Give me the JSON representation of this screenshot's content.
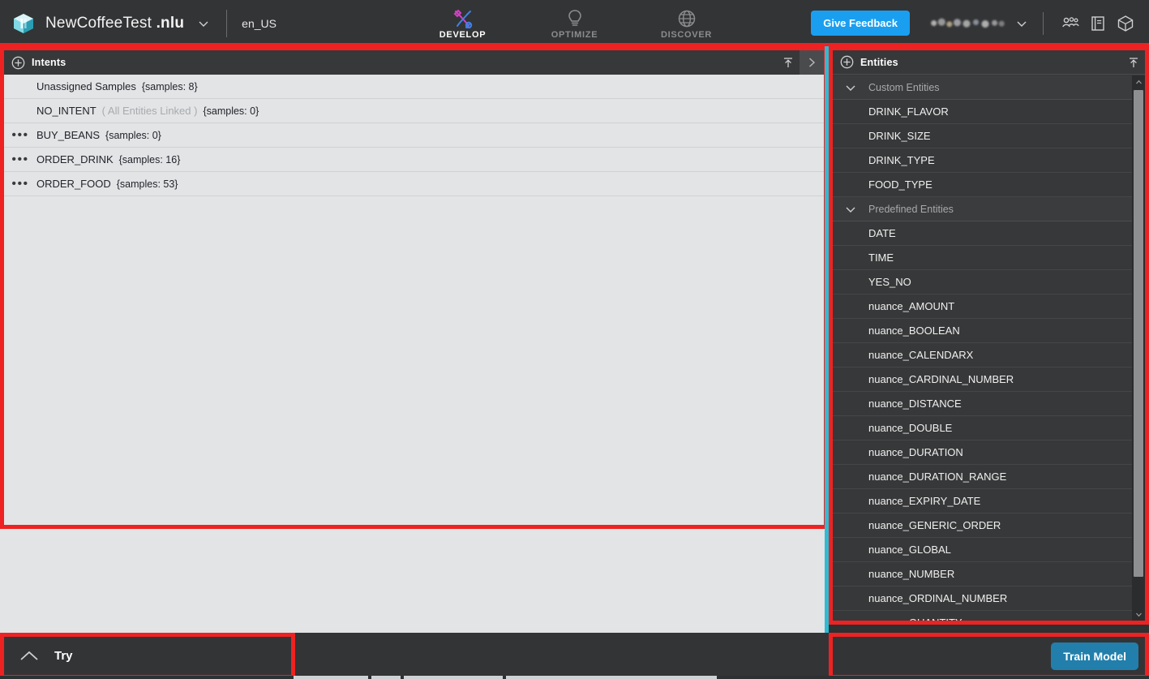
{
  "header": {
    "logo_icon": "nuance-cube-logo",
    "project_name": "NewCoffeeTest ",
    "project_ext": ".nlu",
    "project_caret_icon": "chevron-down-icon",
    "locale": "en_US",
    "feedback_label": "Give Feedback",
    "user_caret_icon": "chevron-down-icon",
    "nav": [
      {
        "label": "DEVELOP",
        "icon": "tools-icon",
        "active": true
      },
      {
        "label": "OPTIMIZE",
        "icon": "lightbulb-icon",
        "active": false
      },
      {
        "label": "DISCOVER",
        "icon": "globe-icon",
        "active": false
      }
    ],
    "icons": [
      {
        "name": "users-group-icon"
      },
      {
        "name": "book-icon"
      },
      {
        "name": "cube-icon"
      }
    ]
  },
  "intents_panel": {
    "title": "Intents",
    "add_icon": "plus-circle-icon",
    "collapse_icon": "collapse-up-icon",
    "expand_icon": "chevron-right-icon",
    "rows": [
      {
        "menu": false,
        "name": "Unassigned Samples",
        "sub": "",
        "count": "{samples: 8}"
      },
      {
        "menu": false,
        "name": "NO_INTENT",
        "sub": "( All Entities Linked )",
        "count": "{samples: 0}"
      },
      {
        "menu": true,
        "name": "BUY_BEANS",
        "sub": "",
        "count": "{samples: 0}"
      },
      {
        "menu": true,
        "name": "ORDER_DRINK",
        "sub": "",
        "count": "{samples: 16}"
      },
      {
        "menu": true,
        "name": "ORDER_FOOD",
        "sub": "",
        "count": "{samples: 53}"
      }
    ]
  },
  "entities_panel": {
    "title": "Entities",
    "add_icon": "plus-circle-icon",
    "collapse_icon": "collapse-up-icon",
    "groups": [
      {
        "label": "Custom Entities",
        "chevron_icon": "chevron-down-icon",
        "items": [
          "DRINK_FLAVOR",
          "DRINK_SIZE",
          "DRINK_TYPE",
          "FOOD_TYPE"
        ]
      },
      {
        "label": "Predefined Entities",
        "chevron_icon": "chevron-down-icon",
        "items": [
          "DATE",
          "TIME",
          "YES_NO",
          "nuance_AMOUNT",
          "nuance_BOOLEAN",
          "nuance_CALENDARX",
          "nuance_CARDINAL_NUMBER",
          "nuance_DISTANCE",
          "nuance_DOUBLE",
          "nuance_DURATION",
          "nuance_DURATION_RANGE",
          "nuance_EXPIRY_DATE",
          "nuance_GENERIC_ORDER",
          "nuance_GLOBAL",
          "nuance_NUMBER",
          "nuance_ORDINAL_NUMBER",
          "nuance_QUANTITY"
        ]
      }
    ],
    "scrollbar": {
      "up_icon": "scroll-up-arrow",
      "down_icon": "scroll-down-arrow"
    }
  },
  "try_panel": {
    "label": "Try",
    "chevron_icon": "chevron-up-icon"
  },
  "train_panel": {
    "label": "Train Model"
  },
  "colors": {
    "annotation_red": "#ee2222",
    "accent_blue": "#1a9ff0",
    "train_blue": "#227fac",
    "divider_cyan": "#2bbcd4",
    "panel_dark": "#333436",
    "list_light": "#e2e4e6"
  }
}
